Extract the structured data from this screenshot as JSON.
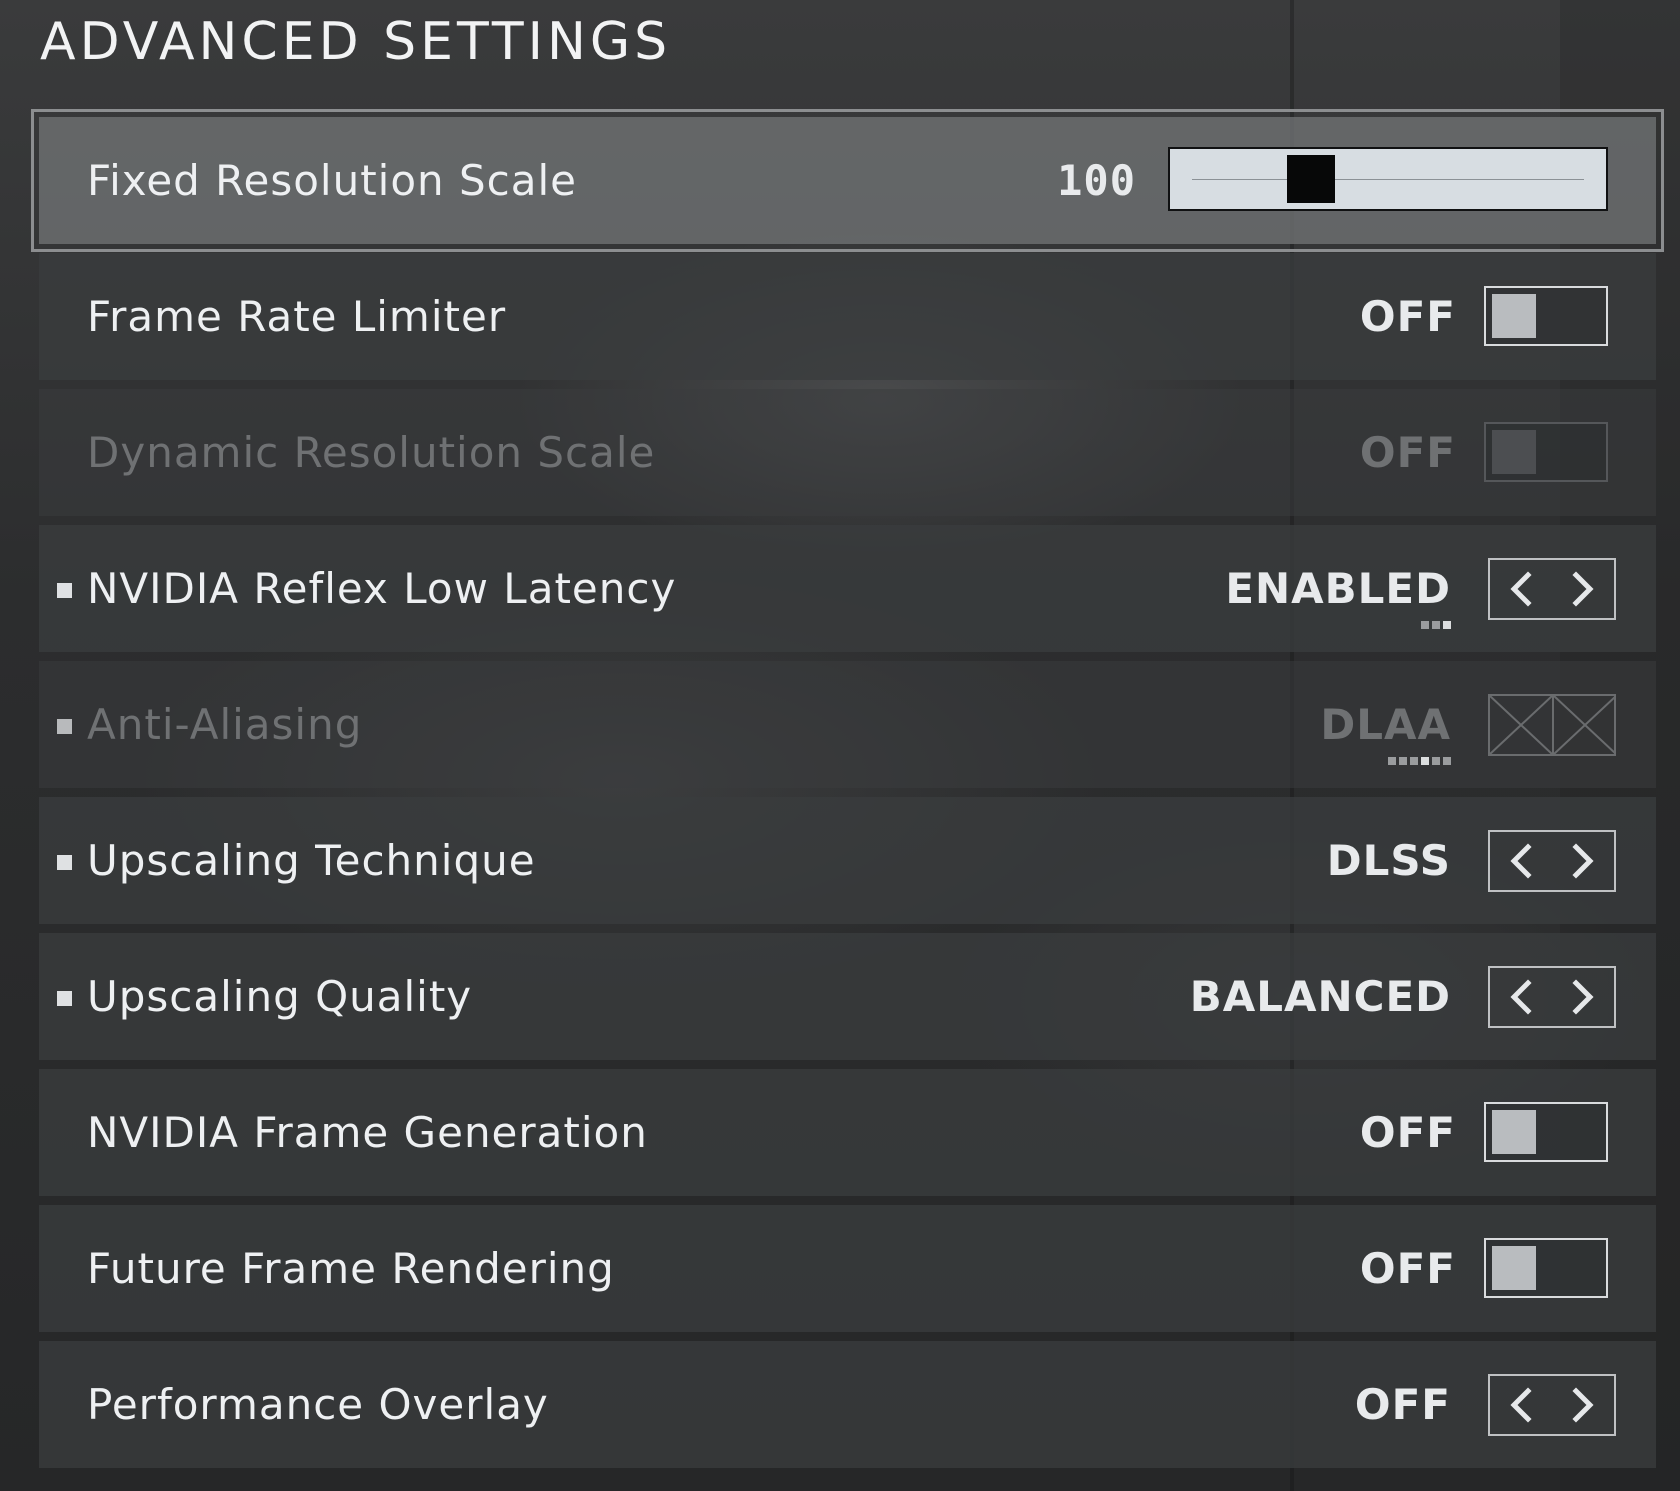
{
  "page": {
    "title": "ADVANCED SETTINGS"
  },
  "settings": [
    {
      "label": "Fixed Resolution Scale",
      "value": "100",
      "control": "slider",
      "slider_fraction": 0.3,
      "selected": true,
      "disabled": false,
      "bullet": false
    },
    {
      "label": "Frame Rate Limiter",
      "value": "OFF",
      "control": "toggle",
      "selected": false,
      "disabled": false,
      "bullet": false
    },
    {
      "label": "Dynamic Resolution Scale",
      "value": "OFF",
      "control": "toggle",
      "selected": false,
      "disabled": true,
      "bullet": false
    },
    {
      "label": "NVIDIA Reflex Low Latency",
      "value": "ENABLED",
      "control": "selector",
      "selected": false,
      "disabled": false,
      "bullet": true,
      "option_count": 3,
      "option_index": 2
    },
    {
      "label": "Anti-Aliasing",
      "value": "DLAA",
      "control": "selector",
      "selected": false,
      "disabled": true,
      "bullet": true,
      "option_count": 6,
      "option_index": 3
    },
    {
      "label": "Upscaling Technique",
      "value": "DLSS",
      "control": "selector",
      "selected": false,
      "disabled": false,
      "bullet": true
    },
    {
      "label": "Upscaling Quality",
      "value": "BALANCED",
      "control": "selector",
      "selected": false,
      "disabled": false,
      "bullet": true
    },
    {
      "label": "NVIDIA Frame Generation",
      "value": "OFF",
      "control": "toggle",
      "selected": false,
      "disabled": false,
      "bullet": false
    },
    {
      "label": "Future Frame Rendering",
      "value": "OFF",
      "control": "toggle",
      "selected": false,
      "disabled": false,
      "bullet": false
    },
    {
      "label": "Performance Overlay",
      "value": "OFF",
      "control": "selector",
      "selected": false,
      "disabled": false,
      "bullet": false
    }
  ],
  "icons": {
    "left": "chevron-left-icon",
    "right": "chevron-right-icon",
    "disabled": "crossed-box-icon"
  },
  "colors": {
    "panel": "#3a3c3e",
    "selected_panel": "#6e7072",
    "slider_bg": "#d7dde2",
    "text": "#eef0f2",
    "disabled_text": "#6f7173"
  }
}
